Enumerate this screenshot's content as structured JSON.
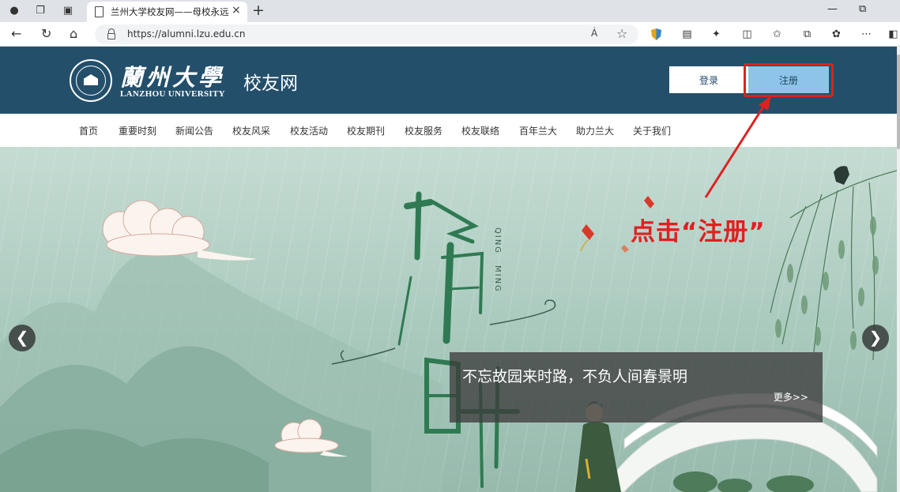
{
  "browser": {
    "tab_title": "兰州大学校友网——母校永远是你",
    "tab_close": "×",
    "new_tab": "+",
    "url": "https://alumni.lzu.edu.cn",
    "read_aloud": "Á",
    "window_minimize": "—",
    "window_restore": "⧉"
  },
  "header": {
    "logo_cn": "蘭州大學",
    "logo_en": "LANZHOU UNIVERSITY",
    "site_name": "校友网",
    "login_label": "登录",
    "register_label": "注册",
    "brand_color": "#234f6b",
    "register_color": "#8ec4e8"
  },
  "nav": {
    "items": [
      "首页",
      "重要时刻",
      "新闻公告",
      "校友风采",
      "校友活动",
      "校友期刊",
      "校友服务",
      "校友联络",
      "百年兰大",
      "助力兰大",
      "关于我们"
    ]
  },
  "banner": {
    "pinyin_1": "QING",
    "pinyin_2": "MING",
    "caption": "不忘故园来时路，不负人间春景明",
    "more_label": "更多>>",
    "prev_label": "❮",
    "next_label": "❯"
  },
  "annotation": {
    "text": "点击“注册”",
    "color": "#e02020"
  }
}
